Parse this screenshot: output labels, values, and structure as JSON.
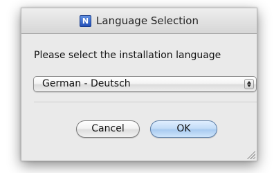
{
  "dialog": {
    "title": "Language Selection",
    "app_icon_letter": "N",
    "prompt": "Please select the installation language",
    "language_select": {
      "selected": "German - Deutsch"
    },
    "buttons": {
      "cancel_label": "Cancel",
      "ok_label": "OK"
    },
    "colors": {
      "window_bg": "#eaeaea",
      "default_button": "#bcd6f4",
      "app_icon": "#2f5fc8"
    }
  }
}
